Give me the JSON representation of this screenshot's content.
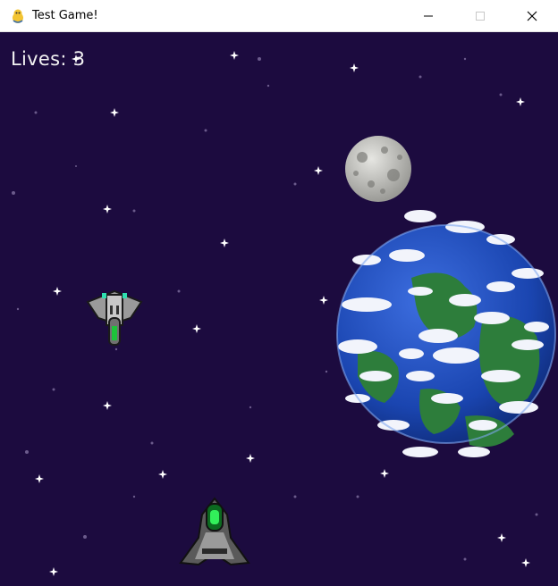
{
  "window": {
    "title": "Test Game!",
    "icon": "pygame-snake-icon"
  },
  "controls": {
    "minimize": "minimize-icon",
    "maximize": "maximize-icon",
    "close": "close-icon"
  },
  "hud": {
    "lives_text": "Lives: 3"
  },
  "colors": {
    "background": "#1c0b3f",
    "star": "#ffffff",
    "ocean": "#1e49b8",
    "land": "#2a7a3a",
    "moon": "#c8c8c4"
  }
}
